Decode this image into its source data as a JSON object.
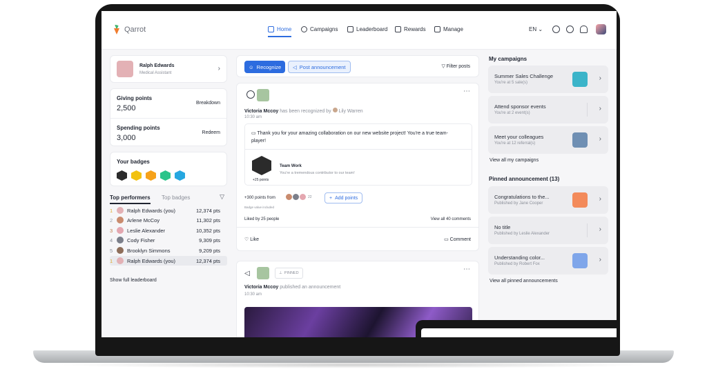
{
  "app": {
    "brand": "Qarrot",
    "accent": "#2d6cdf"
  },
  "nav": [
    {
      "label": "Home",
      "icon": "home-icon",
      "active": true
    },
    {
      "label": "Campaigns",
      "icon": "target-icon"
    },
    {
      "label": "Leaderboard",
      "icon": "podium-icon"
    },
    {
      "label": "Rewards",
      "icon": "gift-icon"
    },
    {
      "label": "Manage",
      "icon": "tools-icon"
    }
  ],
  "topbar": {
    "language": "EN"
  },
  "profile": {
    "name": "Ralph Edwards",
    "role": "Medical Assistant"
  },
  "points": {
    "giving_label": "Giving points",
    "giving_value": "2,500",
    "giving_action": "Breakdown",
    "spending_label": "Spending points",
    "spending_value": "3,000",
    "spending_action": "Redeem"
  },
  "badges": {
    "title": "Your badges",
    "colors": [
      "#2b2b2b",
      "#f2c20f",
      "#f6a21a",
      "#2bc48a",
      "#26a7e0"
    ]
  },
  "leaderboard": {
    "tab_active": "Top performers",
    "tab_inactive": "Top badges",
    "rows": [
      {
        "rank": "1",
        "name": "Ralph Edwards (you)",
        "pts": "12,374 pts",
        "rank_color": "#e0a82e"
      },
      {
        "rank": "2",
        "name": "Arlene McCoy",
        "pts": "11,302 pts",
        "rank_color": "#9aa0aa"
      },
      {
        "rank": "3",
        "name": "Leslie Alexander",
        "pts": "10,352 pts",
        "rank_color": "#c07a4a"
      },
      {
        "rank": "4",
        "name": "Cody Fisher",
        "pts": "9,309 pts",
        "rank_color": "#8b8f99"
      },
      {
        "rank": "5",
        "name": "Brooklyn Simmons",
        "pts": "9,209 pts",
        "rank_color": "#8b8f99"
      },
      {
        "rank": "1",
        "name": "Ralph Edwards (you)",
        "pts": "12,374 pts",
        "rank_color": "#e0a82e"
      }
    ],
    "footer": "Show full leaderboard"
  },
  "feed": {
    "recognize": "Recognize",
    "announce": "Post announcement",
    "filter": "Filter posts",
    "post1": {
      "author": "Victoria Mccoy",
      "verb": "has been recognized by",
      "by": "Lily Warren",
      "time": "10:30 am",
      "message": "Thank you for your amazing collaboration on our new website project! You're a true team-player!",
      "badge_title": "Team Work",
      "badge_desc": "You're a tremendous contributor to our team!",
      "badge_pts": "+25 points",
      "points_from": "+300 points from",
      "extra_count": "22",
      "add_points": "Add points",
      "note": "Badge value included",
      "likes": "Liked by 25 people",
      "comments": "View all 40 comments",
      "like": "Like",
      "comment": "Comment"
    },
    "post2": {
      "pinned": "PINNED",
      "author": "Victoria Mccoy",
      "verb": "published an announcement",
      "time": "10:30 am"
    }
  },
  "campaigns": {
    "title": "My campaigns",
    "items": [
      {
        "title": "Summer Sales Challenge",
        "sub": "You're at 5 sale(s)",
        "thumb": "#3bb4c9"
      },
      {
        "title": "Attend sponsor events",
        "sub": "You're at 2 event(s)",
        "thumb": ""
      },
      {
        "title": "Meet your colleagues",
        "sub": "You're at 12 referral(s)",
        "thumb": "#6f8fb3"
      }
    ],
    "view_all": "View all my campaigns"
  },
  "pinned": {
    "title": "Pinned announcement (13)",
    "items": [
      {
        "title": "Congratulations to the...",
        "sub": "Published by Jane Cooper",
        "thumb": "#f38a5a"
      },
      {
        "title": "No title",
        "sub": "Published by Leslie Alexander",
        "thumb": ""
      },
      {
        "title": "Understanding color...",
        "sub": "Published by Robert Fox",
        "thumb": "#7fa6ea"
      }
    ],
    "view_all": "View all pinned announcements"
  }
}
